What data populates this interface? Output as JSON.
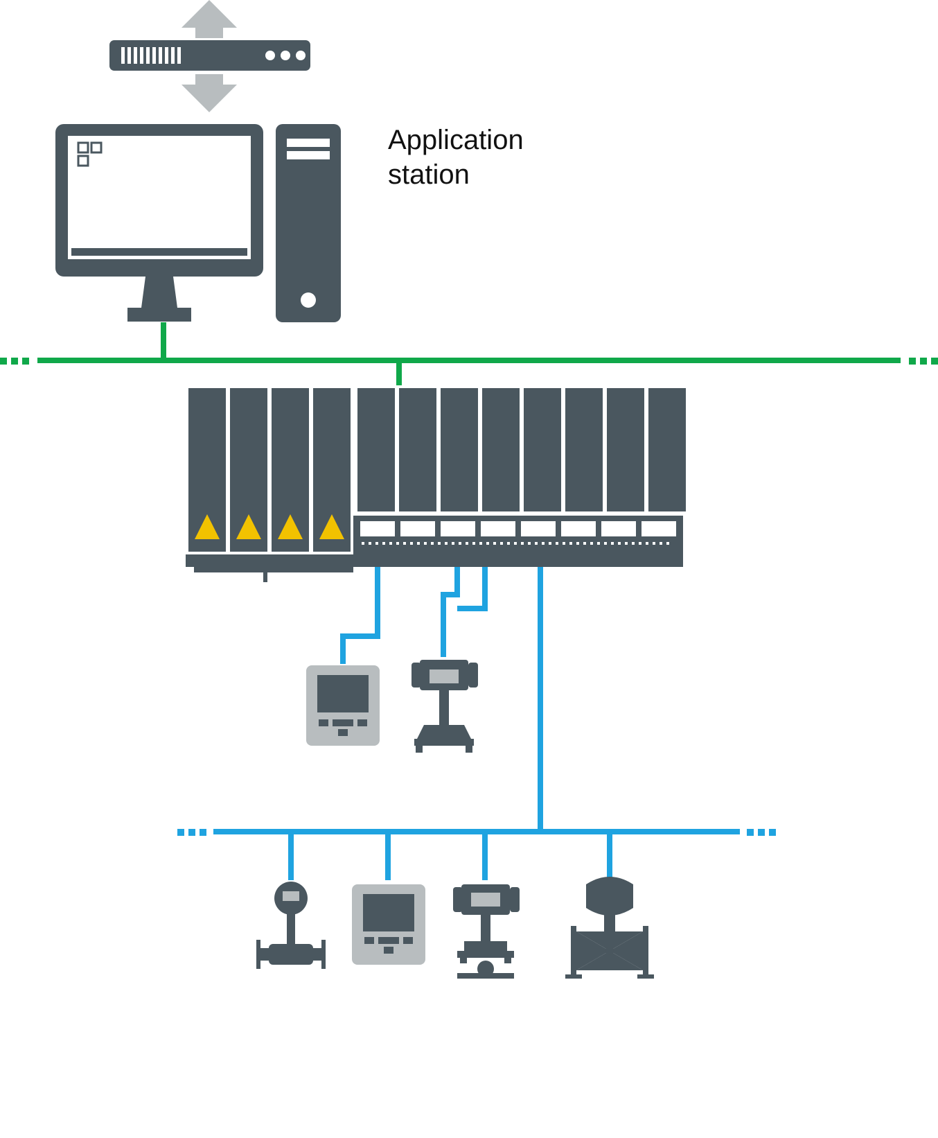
{
  "labels": {
    "application_station_line1": "Application",
    "application_station_line2": "station"
  },
  "colors": {
    "dark": "#4a575f",
    "light_grey": "#b8bdbf",
    "green": "#10a84a",
    "blue": "#1fa3e0",
    "yellow": "#f2c200",
    "white": "#ffffff"
  }
}
